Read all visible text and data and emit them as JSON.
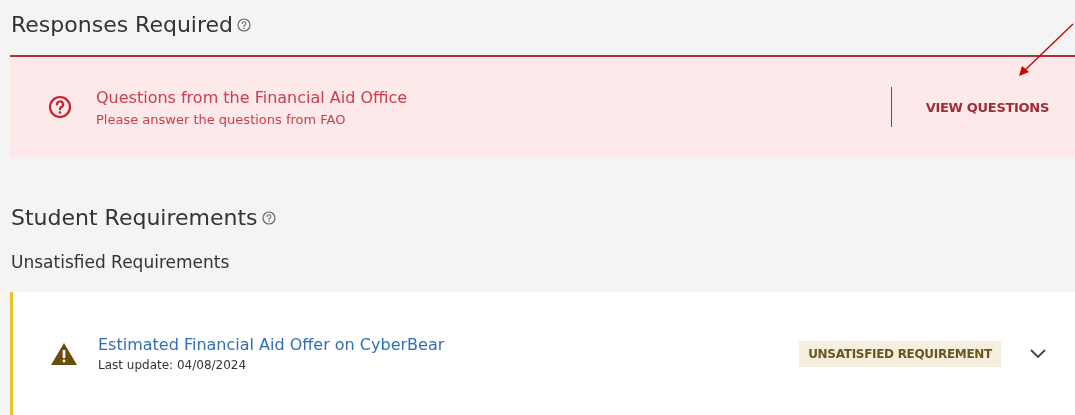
{
  "responses": {
    "title": "Responses Required",
    "alert": {
      "title": "Questions from the Financial Aid Office",
      "message": "Please answer the questions from FAO",
      "action": "VIEW QUESTIONS"
    }
  },
  "student_requirements": {
    "title": "Student Requirements",
    "subtitle": "Unsatisfied Requirements",
    "items": [
      {
        "title": "Estimated Financial Aid Offer on CyberBear",
        "updated": "Last update: 04/08/2024",
        "status": "UNSATISFIED REQUIREMENT",
        "kind": "unsatisfied",
        "expanded": false
      }
    ]
  }
}
